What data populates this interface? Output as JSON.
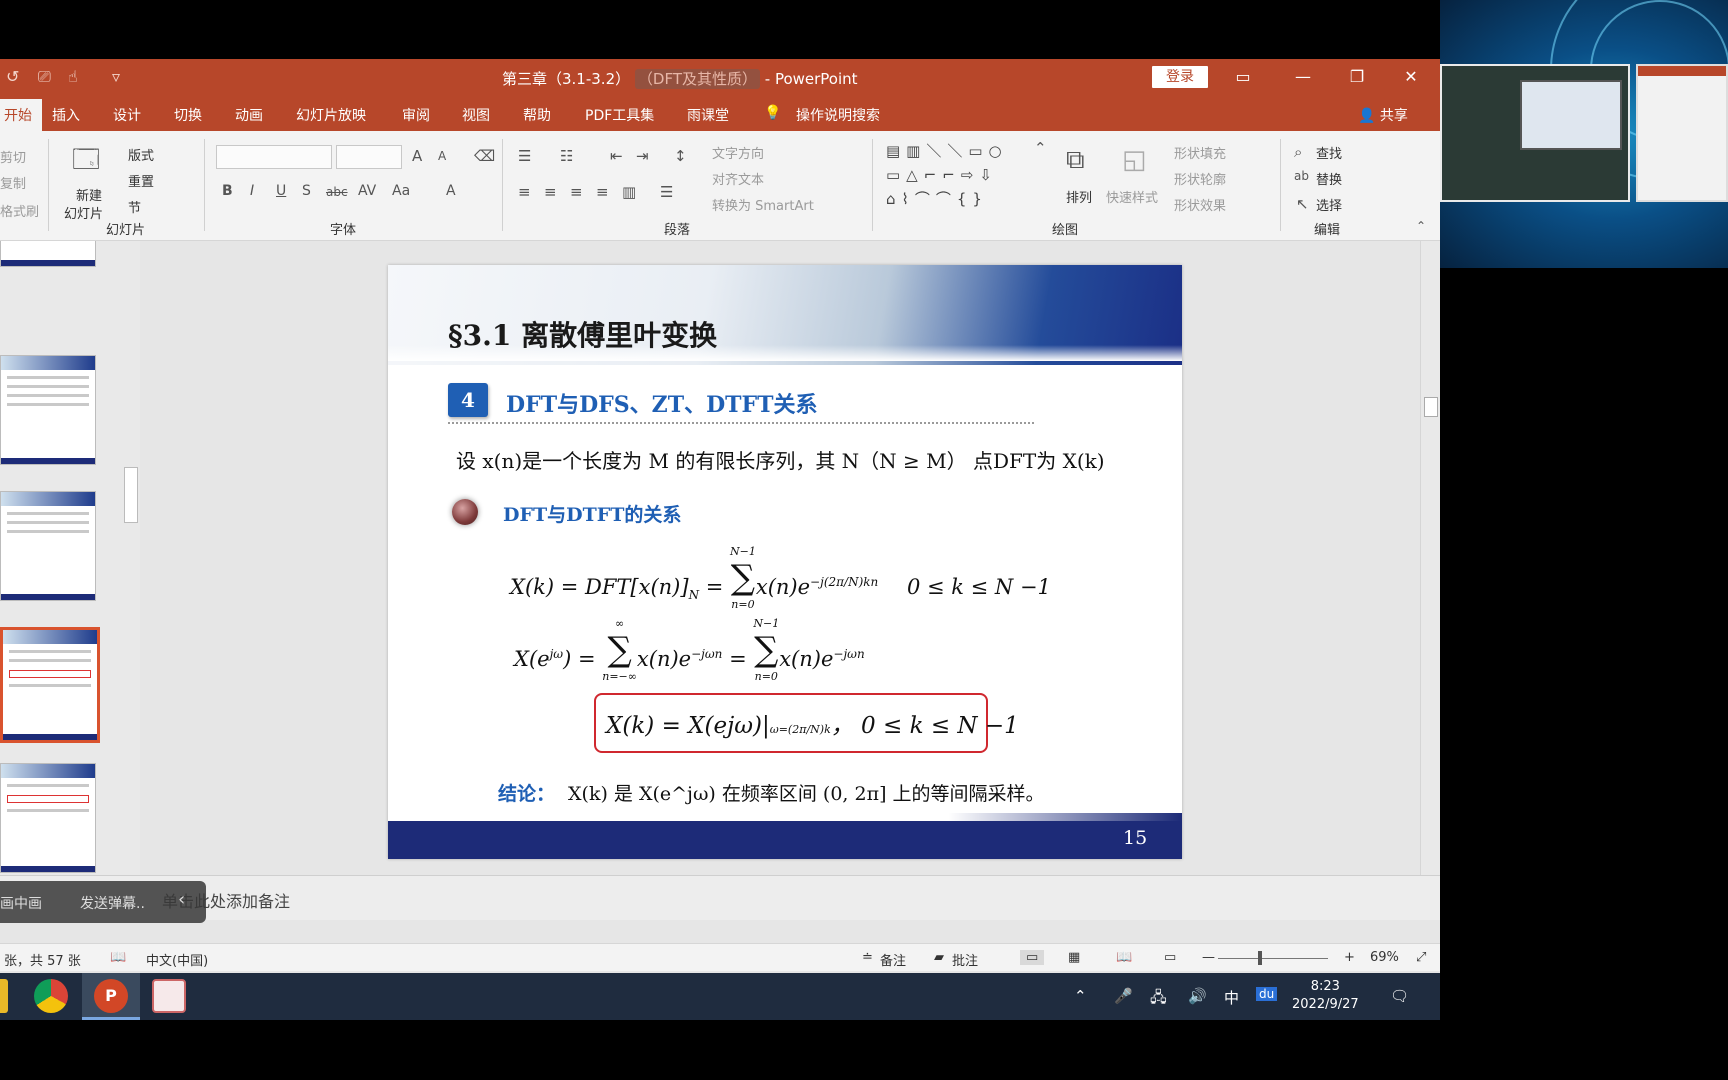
{
  "window": {
    "title_main": "第三章（3.1-3.2）",
    "title_ghost": "（DFT及其性质）",
    "title_app": "- PowerPoint",
    "login": "登录",
    "controls": [
      "▭",
      "—",
      "❐",
      "✕"
    ]
  },
  "tabs": [
    {
      "label": "开始",
      "active": true
    },
    {
      "label": "插入"
    },
    {
      "label": "设计"
    },
    {
      "label": "切换"
    },
    {
      "label": "动画"
    },
    {
      "label": "幻灯片放映"
    },
    {
      "label": "审阅"
    },
    {
      "label": "视图"
    },
    {
      "label": "帮助"
    },
    {
      "label": "PDF工具集"
    },
    {
      "label": "雨课堂"
    },
    {
      "label": "操作说明搜索"
    }
  ],
  "share": "共享",
  "ribbon": {
    "clipboard": [
      "剪切",
      "复制",
      "格式刷"
    ],
    "new_slide": "新建",
    "new_slide_2": "幻灯片",
    "layout": "版式",
    "reset": "重置",
    "section": "节",
    "group_slides": "幻灯片",
    "group_font": "字体",
    "text_direction": "文字方向",
    "align_text": "对齐文本",
    "smartart": "转换为 SmartArt",
    "group_paragraph": "段落",
    "arrange": "排列",
    "quick_styles": "快速样式",
    "shape_fill": "形状填充",
    "shape_outline": "形状轮廓",
    "shape_effects": "形状效果",
    "group_drawing": "绘图",
    "find": "查找",
    "replace": "替换",
    "select": "选择",
    "group_editing": "编辑"
  },
  "slide": {
    "section_title": "§3.1  离散傅里叶变换",
    "badge": "4",
    "subtitle": "DFT与DFS、ZT、DTFT关系",
    "intro": "设 x(n)是一个长度为 M 的有限长序列，其 N（N ≥ M） 点DFT为 X(k)",
    "bullet": "DFT与DTFT的关系",
    "eq1_left": "X(k) = DFT[x(n)]",
    "eq1_sub": "N",
    "eq1_mid": " = ",
    "eq1_sum_top": "N−1",
    "eq1_sum_bot": "n=0",
    "eq1_term": "x(n)e",
    "eq1_exp": "−j(2π/N)kn",
    "eq1_range": "0 ≤ k ≤ N −1",
    "eq2_left": "X(e",
    "eq2_left_exp": "jω",
    "eq2_left_end": ") = ",
    "eq2_sum1_top": "∞",
    "eq2_sum1_bot": "n=−∞",
    "eq2_term1": "x(n)e",
    "eq2_term1_exp": "−jωn",
    "eq2_eq": " = ",
    "eq2_sum2_top": "N−1",
    "eq2_sum2_bot": "n=0",
    "eq2_term2": "x(n)e",
    "eq2_term2_exp": "−jωn",
    "result_left": "X(k) = X(e",
    "result_exp": "jω",
    "result_mid": ")|",
    "result_sub": "ω=(2π/N)k",
    "result_range": "，   0 ≤ k ≤ N −1",
    "conclusion_label": "结论：",
    "conclusion": "X(k) 是  X(e^jω) 在频率区间 (0, 2π] 上的等间隔采样。",
    "page_number": "15"
  },
  "notes": {
    "hint": "单击此处添加备注",
    "overlay_left": "画中画",
    "overlay_right": "发送弹幕..",
    "overlay_arrow": "‹"
  },
  "status": {
    "slide_info": "张，共 57 张",
    "language": "中文(中国)",
    "notes": "备注",
    "comments": "批注",
    "zoom_minus": "—",
    "zoom_plus": "+",
    "zoom": "69%"
  },
  "taskbar": {
    "time": "8:23",
    "date": "2022/9/27",
    "ime": "中",
    "du": "du"
  },
  "colors": {
    "brand": "#b7472a",
    "slide_blue": "#1f5fb4",
    "slide_footer": "#1d2b78",
    "result_border": "#d0282f"
  }
}
